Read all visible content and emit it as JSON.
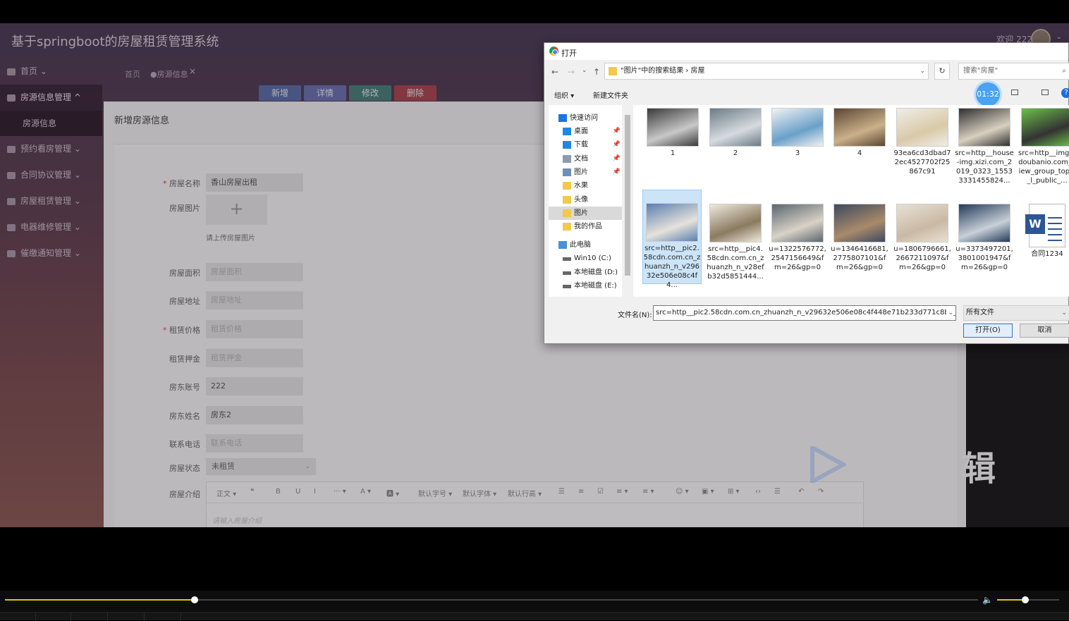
{
  "app": {
    "title": "基于springboot的房屋租赁管理系统",
    "welcome": "欢迎 222",
    "caret": "⌄"
  },
  "sidebar": {
    "items": [
      {
        "label": "首页 ⌄",
        "icon": "home-icon"
      },
      {
        "label": "房源信息管理 ^",
        "icon": "house-icon"
      },
      {
        "label": "房源信息",
        "sub": true
      },
      {
        "label": "预约看房管理 ⌄",
        "icon": "calendar-icon"
      },
      {
        "label": "合同协议管理 ⌄",
        "icon": "contract-icon"
      },
      {
        "label": "房屋租赁管理 ⌄",
        "icon": "rent-icon"
      },
      {
        "label": "电器维修管理 ⌄",
        "icon": "repair-icon"
      },
      {
        "label": "催缴通知管理 ⌄",
        "icon": "bell-icon"
      }
    ]
  },
  "tabs": {
    "home": "首页",
    "current": "●房源信息",
    "close": "×"
  },
  "toolbar": {
    "add": "新增",
    "detail": "详情",
    "edit": "修改",
    "delete": "删除"
  },
  "form": {
    "title": "新增房源信息",
    "fields": [
      {
        "label": "房屋名称",
        "required": true,
        "value": "香山房屋出租",
        "placeholder": ""
      },
      {
        "label": "房屋面积",
        "required": false,
        "value": "",
        "placeholder": "房屋面积"
      },
      {
        "label": "房屋地址",
        "required": false,
        "value": "",
        "placeholder": "房屋地址"
      },
      {
        "label": "租赁价格",
        "required": true,
        "value": "",
        "placeholder": "租赁价格"
      },
      {
        "label": "租赁押金",
        "required": false,
        "value": "",
        "placeholder": "租赁押金"
      },
      {
        "label": "房东账号",
        "required": false,
        "value": "222",
        "placeholder": ""
      },
      {
        "label": "房东姓名",
        "required": false,
        "value": "房东2",
        "placeholder": ""
      },
      {
        "label": "联系电话",
        "required": false,
        "value": "",
        "placeholder": "联系电话"
      }
    ],
    "image_label": "房屋图片",
    "image_plus": "+",
    "image_tip": "请上传房屋图片",
    "status_label": "房屋状态",
    "status_value": "未租赁",
    "status_caret": "⌄",
    "intro_label": "房屋介绍",
    "intro_placeholder": "请输入房屋介绍",
    "editor_tools": [
      "正文 ▾",
      "❝",
      "B",
      "U",
      "I",
      "··· ▾",
      "A ▾",
      "🅰 ▾",
      "默认字号 ▾",
      "默认字体 ▾",
      "默认行高 ▾",
      "☰",
      "≡",
      "☑",
      "≡ ▾",
      "≡ ▾",
      "☺ ▾",
      "▣ ▾",
      "⊞ ▾",
      "‹›",
      "☰",
      "↶",
      "↷"
    ]
  },
  "watermark": {
    "text": "辑"
  },
  "dialog": {
    "title": "打开",
    "breadcrumb": "\"图片\"中的搜索结果  ›  房屋",
    "search_placeholder": "搜索\"房屋\"",
    "nav": {
      "back": "←",
      "forward": "→",
      "recent": "⌄",
      "up": "↑",
      "arrow": "›",
      "dropdown": "⌄",
      "refresh": "↻",
      "search": "⌕"
    },
    "organize": "组织 ▾",
    "new_folder": "新建文件夹",
    "timer": "01:32",
    "help": "?",
    "tree": [
      {
        "label": "快速访问",
        "kind": "star",
        "pin": ""
      },
      {
        "label": "桌面",
        "kind": "desktop",
        "pin": "📌"
      },
      {
        "label": "下载",
        "kind": "download",
        "pin": "📌"
      },
      {
        "label": "文档",
        "kind": "doc",
        "pin": "📌"
      },
      {
        "label": "图片",
        "kind": "pic",
        "pin": "📌"
      },
      {
        "label": "水果",
        "kind": "folder",
        "pin": ""
      },
      {
        "label": "头像",
        "kind": "folder",
        "pin": ""
      },
      {
        "label": "图片",
        "kind": "folder",
        "pin": "",
        "selected": true
      },
      {
        "label": "我的作品",
        "kind": "folder",
        "pin": ""
      },
      {
        "label": "此电脑",
        "kind": "pc",
        "pin": ""
      },
      {
        "label": "Win10 (C:)",
        "kind": "drive",
        "pin": ""
      },
      {
        "label": "本地磁盘 (D:)",
        "kind": "drive",
        "pin": ""
      },
      {
        "label": "本地磁盘 (E:)",
        "kind": "drive",
        "pin": ""
      }
    ],
    "files": [
      {
        "name": "1",
        "colors": [
          "#3a3a3a",
          "#c8c8c8"
        ]
      },
      {
        "name": "2",
        "colors": [
          "#6b7b85",
          "#d7dbe0"
        ]
      },
      {
        "name": "3",
        "colors": [
          "#f2f2f2",
          "#6aa0c9"
        ]
      },
      {
        "name": "4",
        "colors": [
          "#5a4632",
          "#cbb18a"
        ]
      },
      {
        "name": "93ea6cd3dbad72ec4527702f25867c91",
        "colors": [
          "#f0ede6",
          "#d9c9a8"
        ]
      },
      {
        "name": "src=http__house-img.xizi.com_2019_0323_15533331455824...",
        "colors": [
          "#2f2f2f",
          "#d8d0c0"
        ]
      },
      {
        "name": "src=http__img3.doubanio.com_view_group_topic_l_public_...",
        "colors": [
          "#6cc04a",
          "#333"
        ]
      },
      {
        "name": "src=http__pic2.58cdn.com.cn_zhuanzh_n_v29632e506e08c4f4...",
        "colors": [
          "#5a7fb0",
          "#e6e2da"
        ],
        "selected": true
      },
      {
        "name": "src=http__pic4.58cdn.com.cn_zhuanzh_n_v28efb32d5851444...",
        "colors": [
          "#efe9dd",
          "#8a7a60"
        ]
      },
      {
        "name": "u=1322576772,2547156649&fm=26&gp=0",
        "colors": [
          "#5a6670",
          "#d9d2c6"
        ]
      },
      {
        "name": "u=1346416681,2775807101&fm=26&gp=0",
        "colors": [
          "#3d4a60",
          "#a98a6a"
        ]
      },
      {
        "name": "u=1806796661,2667211097&fm=26&gp=0",
        "colors": [
          "#e8e0d5",
          "#c9b9a4"
        ]
      },
      {
        "name": "u=3373497201,3801001947&fm=26&gp=0",
        "colors": [
          "#243a5a",
          "#c8d0d8"
        ]
      },
      {
        "name": "合同1234",
        "word": true
      }
    ],
    "filename_label": "文件名(N):",
    "filename_value": "src=http__pic2.58cdn.com.cn_zhuanzh_n_v29632e506e08c4f448e71b233d771c8b4_750_0",
    "filetype": "所有文件",
    "open": "打开(O)",
    "cancel": "取消"
  },
  "player": {
    "progress": 0.195,
    "volume": 0.45,
    "volume_icon": "🔈"
  }
}
